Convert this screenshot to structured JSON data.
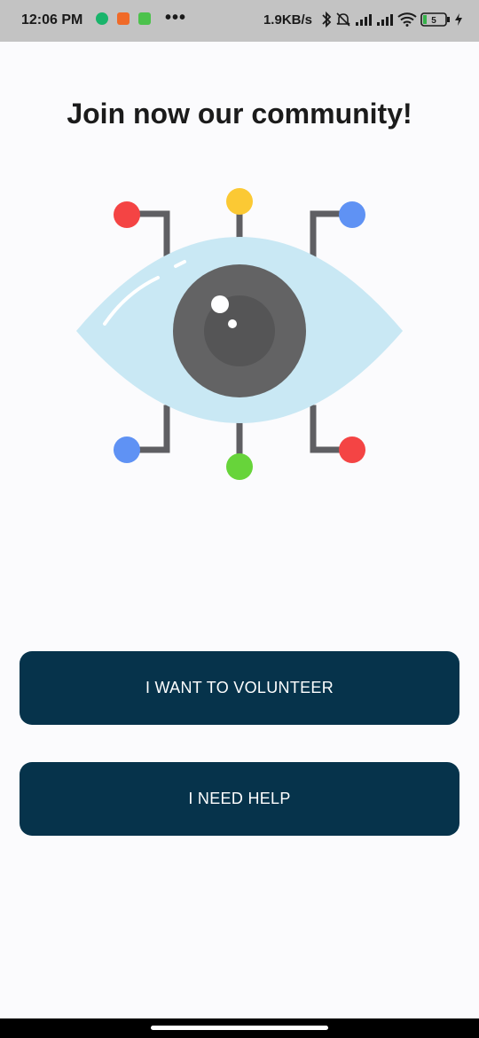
{
  "status_bar": {
    "time": "12:06 PM",
    "more": "•••",
    "net_speed": "1.9KB/s",
    "battery_level": "5",
    "icons": [
      "shield-icon",
      "app-notification-icon",
      "app-notification-icon",
      "bluetooth-icon",
      "mute-bell-icon",
      "signal-icon",
      "signal-icon",
      "wifi-icon",
      "battery-icon",
      "charging-icon"
    ]
  },
  "main": {
    "title": "Join now our community!",
    "illustration": "eye-network-icon"
  },
  "buttons": {
    "volunteer_label": "I WANT TO VOLUNTEER",
    "help_label": "I NEED HELP"
  },
  "colors": {
    "button_bg": "#06334b",
    "page_bg": "#fbfbfd",
    "status_bg": "#c3c3c3"
  }
}
